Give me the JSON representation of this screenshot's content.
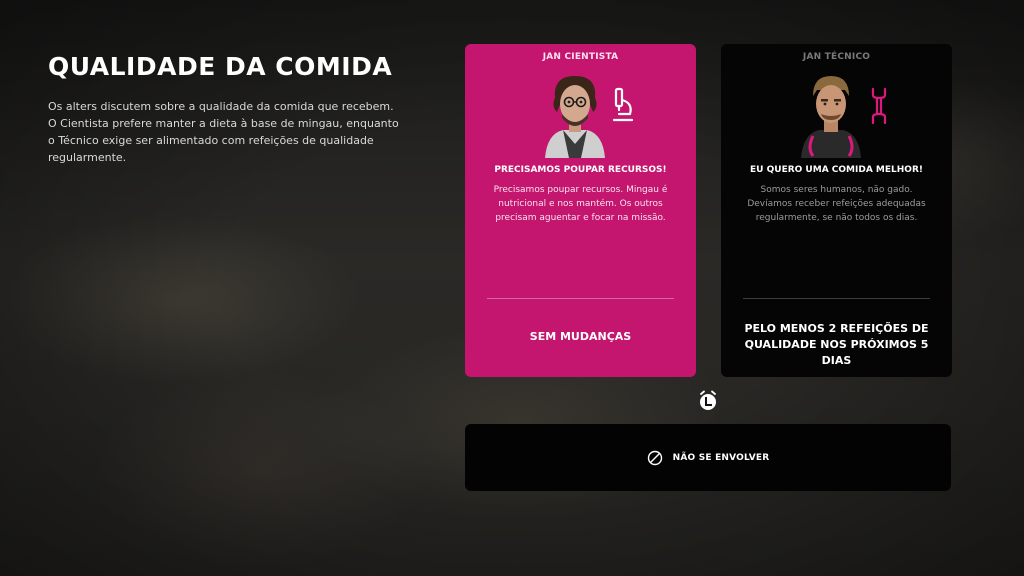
{
  "event": {
    "title": "QUALIDADE DA COMIDA",
    "description": "Os alters discutem sobre a qualidade da comida que recebem. O Cientista prefere manter a dieta à base de mingau, enquanto o Técnico exige ser alimentado com refeições de qualidade regularmente."
  },
  "choices": [
    {
      "name": "JAN CIENTISTA",
      "icon": "microscope-icon",
      "headline": "PRECISAMOS POUPAR RECURSOS!",
      "body": "Precisamos poupar recursos. Mingau é nutricional e nos mantém. Os outros precisam aguentar e focar na missão.",
      "option": "SEM MUDANÇAS",
      "color": "#c4166f",
      "selected": true
    },
    {
      "name": "JAN TÉCNICO",
      "icon": "wrench-icon",
      "headline": "EU QUERO UMA COMIDA MELHOR!",
      "body": "Somos seres humanos, não gado. Devíamos receber refeições adequadas regularmente, se não todos os dias.",
      "option": "PELO MENOS 2 REFEIÇÕES DE QUALIDADE NOS PRÓXIMOS 5 DIAS",
      "color": "#050505",
      "selected": false
    }
  ],
  "skip": {
    "label": "NÃO SE ENVOLVER",
    "icon": "prohibited-icon"
  },
  "timer_icon": "alarm-clock-icon",
  "accent": "#e0177f"
}
